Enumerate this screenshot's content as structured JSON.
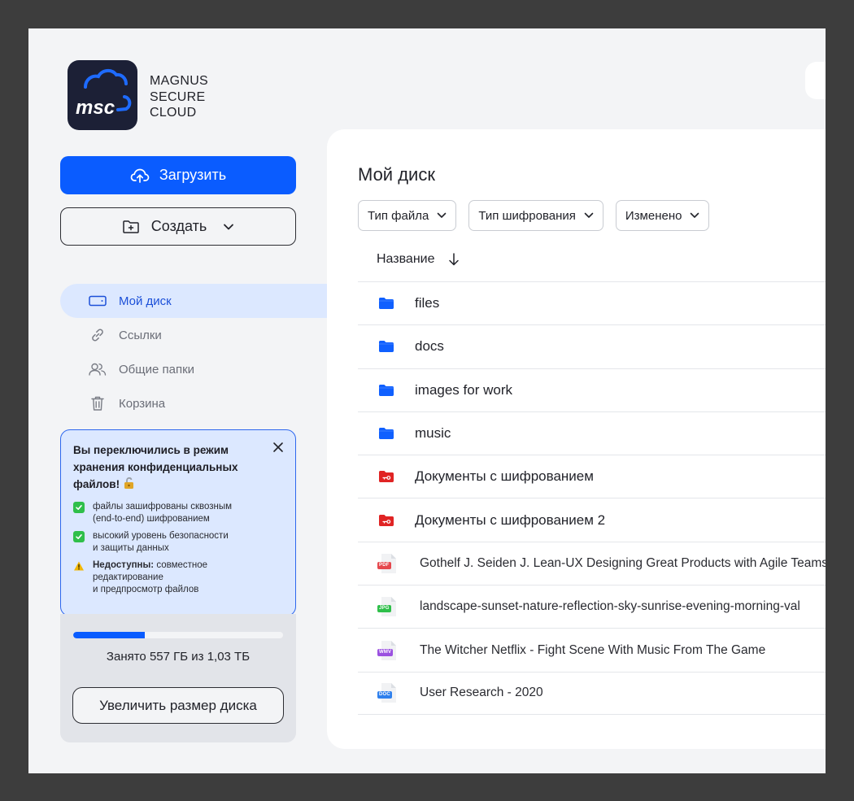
{
  "brand": {
    "logo_text": "msc",
    "name_lines": [
      "MAGNUS",
      "SECURE",
      "CLOUD"
    ]
  },
  "sidebar": {
    "upload_label": "Загрузить",
    "create_label": "Создать",
    "nav": [
      {
        "label": "Мой диск",
        "icon": "drive-icon",
        "active": true
      },
      {
        "label": "Ссылки",
        "icon": "link-icon",
        "active": false
      },
      {
        "label": "Общие папки",
        "icon": "users-icon",
        "active": false
      },
      {
        "label": "Корзина",
        "icon": "trash-icon",
        "active": false
      }
    ],
    "notice": {
      "title": "Вы переключились в  режим хранения конфиденциальных файлов!",
      "items": [
        {
          "type": "check",
          "lines": [
            "файлы зашифрованы сквозным",
            "(end-to-end) шифрованием"
          ]
        },
        {
          "type": "check",
          "lines": [
            "высокий уровень безопасности",
            "и защиты данных"
          ]
        },
        {
          "type": "warning",
          "bold": "Недоступны:",
          "lines": [
            " совместное",
            "редактирование",
            "и предпросмотр файлов"
          ]
        }
      ]
    },
    "storage": {
      "used_fraction": 0.34,
      "text": "Занято 557 ГБ из 1,03 ТБ",
      "increase_label": "Увеличить размер диска"
    }
  },
  "main": {
    "title": "Мой диск",
    "filters": [
      "Тип файла",
      "Тип шифрования",
      "Изменено"
    ],
    "column_name": "Название",
    "items": [
      {
        "name": "files",
        "kind": "folder"
      },
      {
        "name": "docs",
        "kind": "folder"
      },
      {
        "name": "images for work",
        "kind": "folder"
      },
      {
        "name": "music",
        "kind": "folder"
      },
      {
        "name": "Документы с шифрованием",
        "kind": "encrypted-folder"
      },
      {
        "name": "Документы с шифрованием 2",
        "kind": "encrypted-folder"
      },
      {
        "name": "Gothelf J. Seiden J. Lean-UX Designing Great Products with Agile Teams",
        "kind": "file",
        "ext": "PDF",
        "color": "#e5484d"
      },
      {
        "name": "landscape-sunset-nature-reflection-sky-sunrise-evening-morning-val",
        "kind": "file",
        "ext": "JPG",
        "color": "#2fbf4a"
      },
      {
        "name": "The Witcher Netflix - Fight Scene With Music From The Game",
        "kind": "file",
        "ext": "WMV",
        "color": "#9b51e0"
      },
      {
        "name": "User Research - 2020",
        "kind": "file",
        "ext": "DOC",
        "color": "#2f80ed"
      }
    ]
  },
  "colors": {
    "accent": "#0a5cff",
    "folder": "#1060ff",
    "encrypted_folder": "#e02424",
    "active_nav_bg": "#dce8ff"
  }
}
